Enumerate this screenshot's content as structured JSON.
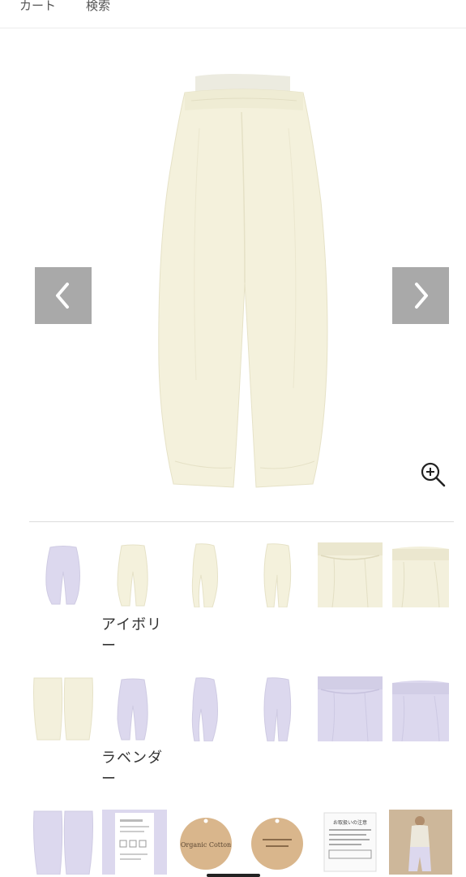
{
  "nav": {
    "cart_label": "カート",
    "search_label": "検索"
  },
  "icons": {
    "prev": "chevron-left-icon",
    "next": "chevron-right-icon",
    "zoom": "zoom-in-icon"
  },
  "colors": {
    "ivory": "#f3f0dc",
    "lavender": "#dcd8ee",
    "arrow_bg": "#a9a9a9"
  },
  "variants": [
    {
      "name": "アイボリー",
      "line1": "アイボリ",
      "line2": "ー"
    },
    {
      "name": "ラベンダー",
      "line1": "ラベンダ",
      "line2": "ー"
    }
  ],
  "care_tag": {
    "title": "お取扱いの注意"
  },
  "brand_tag": {
    "text": "Organic Cotton"
  }
}
